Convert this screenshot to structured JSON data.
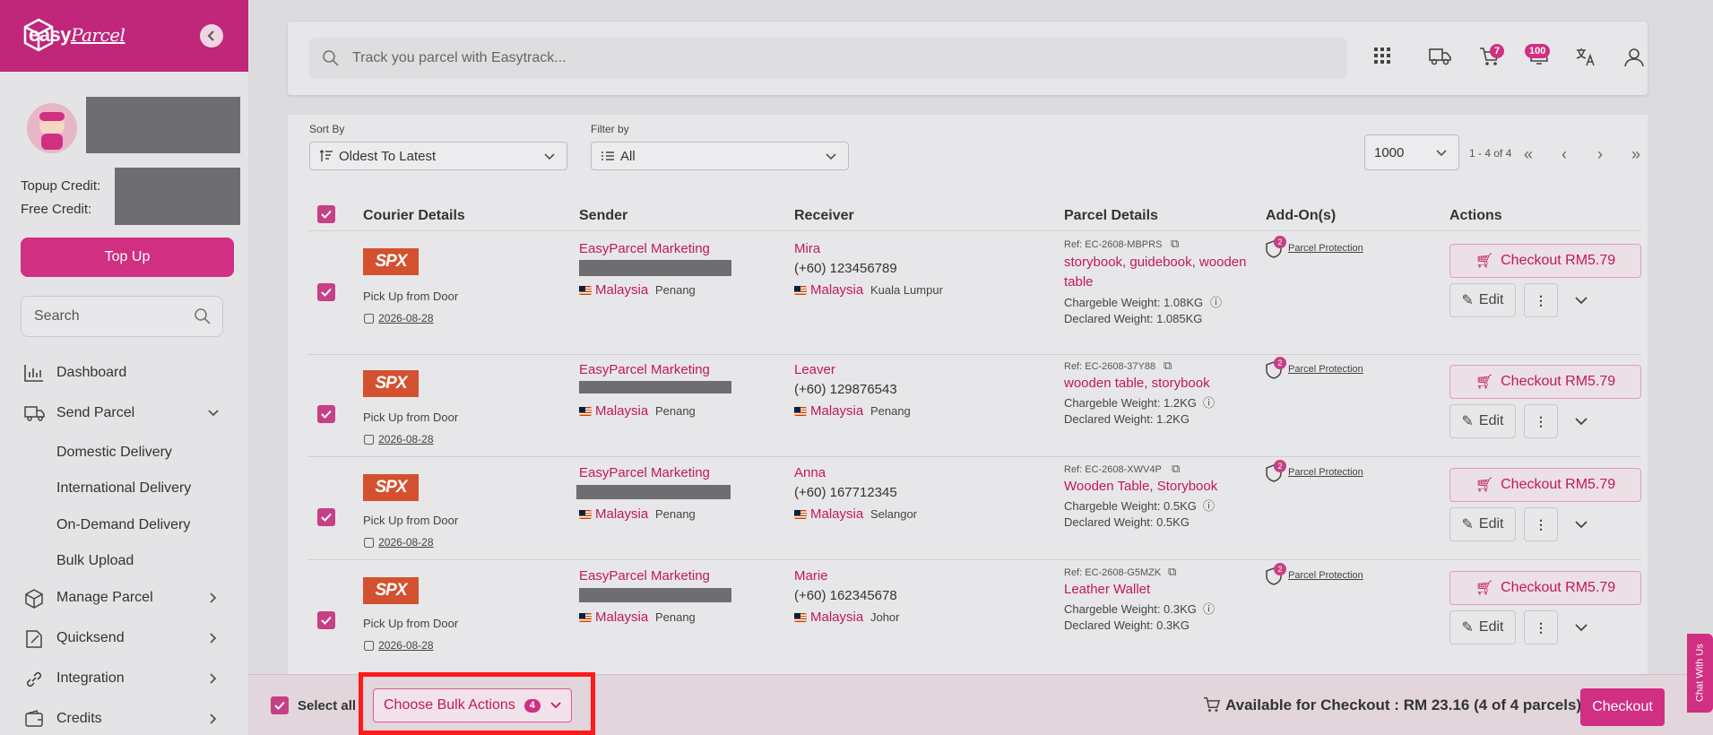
{
  "brand": {
    "name": "easy",
    "name_script": "Parcel"
  },
  "sidebar": {
    "credits": {
      "topup_label": "Topup Credit:",
      "free_label": "Free Credit:"
    },
    "topup_button": "Top Up",
    "search_placeholder": "Search",
    "nav": [
      {
        "label": "Dashboard",
        "icon": "dashboard-icon"
      },
      {
        "label": "Send Parcel",
        "icon": "truck-icon",
        "expanded": true
      },
      {
        "label": "Manage Parcel",
        "icon": "box-icon"
      },
      {
        "label": "Quicksend",
        "icon": "quicksend-icon"
      },
      {
        "label": "Integration",
        "icon": "link-icon"
      },
      {
        "label": "Credits",
        "icon": "wallet-icon"
      }
    ],
    "send_parcel_sub": [
      "Domestic Delivery",
      "International Delivery",
      "On-Demand Delivery",
      "Bulk Upload"
    ],
    "active_sub": "Bulk Upload"
  },
  "topbar": {
    "track_placeholder": "Track you parcel with Easytrack...",
    "cart_count": "7",
    "notif_count": "100"
  },
  "filters": {
    "sort_label": "Sort By",
    "sort_value": "Oldest To Latest",
    "filter_label": "Filter by",
    "filter_value": "All",
    "per_page": "1000",
    "range": "1 - 4 of 4"
  },
  "table": {
    "headers": [
      "Courier Details",
      "Sender",
      "Receiver",
      "Parcel Details",
      "Add-On(s)",
      "Actions"
    ],
    "rows": [
      {
        "courier": "SPX",
        "service": "Pick Up from Door",
        "date": "2026-08-28",
        "sender": "EasyParcel Marketing",
        "sender_country": "Malaysia",
        "sender_state": "Penang",
        "receiver": "Mira",
        "receiver_phone": "(+60) 123456789",
        "receiver_country": "Malaysia",
        "receiver_state": "Kuala Lumpur",
        "ref": "Ref: EC-2608-MBPRS",
        "items": "storybook, guidebook, wooden",
        "items2": "table",
        "chargeable": "Chargeble Weight: 1.08KG",
        "declared": "Declared Weight: 1.085KG",
        "addon_count": "2",
        "addon": "Parcel Protection",
        "checkout": "Checkout RM5.79",
        "edit": "Edit"
      },
      {
        "courier": "SPX",
        "service": "Pick Up from Door",
        "date": "2026-08-28",
        "sender": "EasyParcel Marketing",
        "sender_country": "Malaysia",
        "sender_state": "Penang",
        "receiver": "Leaver",
        "receiver_phone": "(+60) 129876543",
        "receiver_country": "Malaysia",
        "receiver_state": "Penang",
        "ref": "Ref: EC-2608-37Y88",
        "items": "wooden table, storybook",
        "items2": "",
        "chargeable": "Chargeble Weight: 1.2KG",
        "declared": "Declared Weight: 1.2KG",
        "addon_count": "2",
        "addon": "Parcel Protection",
        "checkout": "Checkout RM5.79",
        "edit": "Edit"
      },
      {
        "courier": "SPX",
        "service": "Pick Up from Door",
        "date": "2026-08-28",
        "sender": "EasyParcel Marketing",
        "sender_country": "Malaysia",
        "sender_state": "Penang",
        "receiver": "Anna",
        "receiver_phone": "(+60) 167712345",
        "receiver_country": "Malaysia",
        "receiver_state": "Selangor",
        "ref": "Ref: EC-2608-XWV4P",
        "items": "Wooden Table, Storybook",
        "items2": "",
        "chargeable": "Chargeble Weight: 0.5KG",
        "declared": "Declared Weight: 0.5KG",
        "addon_count": "2",
        "addon": "Parcel Protection",
        "checkout": "Checkout RM5.79",
        "edit": "Edit"
      },
      {
        "courier": "SPX",
        "service": "Pick Up from Door",
        "date": "2026-08-28",
        "sender": "EasyParcel Marketing",
        "sender_country": "Malaysia",
        "sender_state": "Penang",
        "receiver": "Marie",
        "receiver_phone": "(+60) 162345678",
        "receiver_country": "Malaysia",
        "receiver_state": "Johor",
        "ref": "Ref: EC-2608-G5MZK",
        "items": "Leather Wallet",
        "items2": "",
        "chargeable": "Chargeble Weight: 0.3KG",
        "declared": "Declared Weight: 0.3KG",
        "addon_count": "2",
        "addon": "Parcel Protection",
        "checkout": "Checkout RM5.79",
        "edit": "Edit"
      }
    ]
  },
  "bottom": {
    "select_all": "Select all",
    "bulk_actions": "Choose Bulk Actions",
    "bulk_count": "4",
    "available": "Available for Checkout : RM 23.16 (4 of 4 parcels)",
    "checkout": "Checkout"
  },
  "chat": "Chat With Us",
  "colors": {
    "brand": "#c0267a",
    "accent": "#d02f82",
    "highlight": "#ff1a1a"
  }
}
